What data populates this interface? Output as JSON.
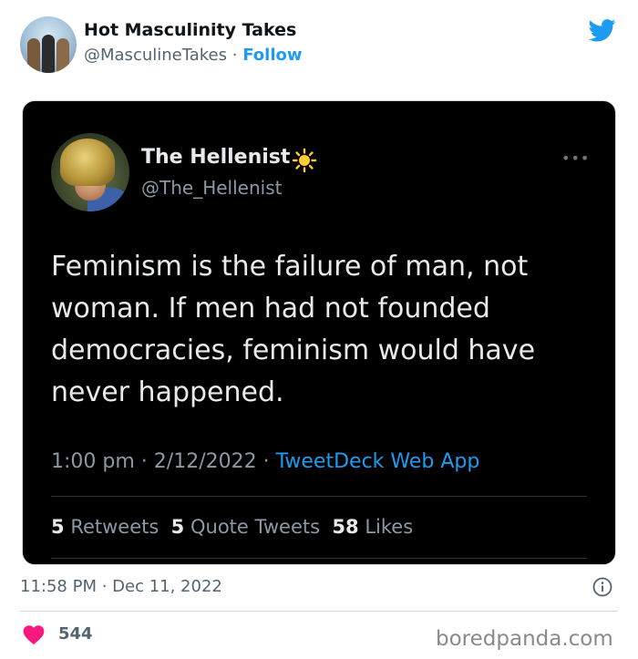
{
  "header": {
    "display_name": "Hot Masculinity Takes",
    "handle": "@MasculineTakes",
    "separator": "·",
    "follow_label": "Follow",
    "logo_icon": "twitter-bird-icon"
  },
  "embedded_tweet": {
    "display_name": "The Hellenist",
    "name_emoji_icon": "sun-icon",
    "handle": "@The_Hellenist",
    "more_icon": "more-dots-icon",
    "text": "Feminism is the failure of man, not woman.  If men had not founded democracies, feminism would have never happened.",
    "time": "1:00 pm",
    "date": "2/12/2022",
    "separator": "·",
    "source_app": "TweetDeck Web App",
    "retweets_count": "5",
    "retweets_label": "Retweets",
    "quote_count": "5",
    "quote_label": "Quote Tweets",
    "likes_count": "58",
    "likes_label": "Likes"
  },
  "footer": {
    "timestamp": "11:58 PM · Dec 11, 2022",
    "info_icon": "info-icon",
    "like_icon": "heart-icon",
    "like_count": "544",
    "like_color": "#f91880",
    "watermark": "boredpanda.com"
  },
  "colors": {
    "accent": "#1d9bf0",
    "card_bg": "#000000"
  }
}
